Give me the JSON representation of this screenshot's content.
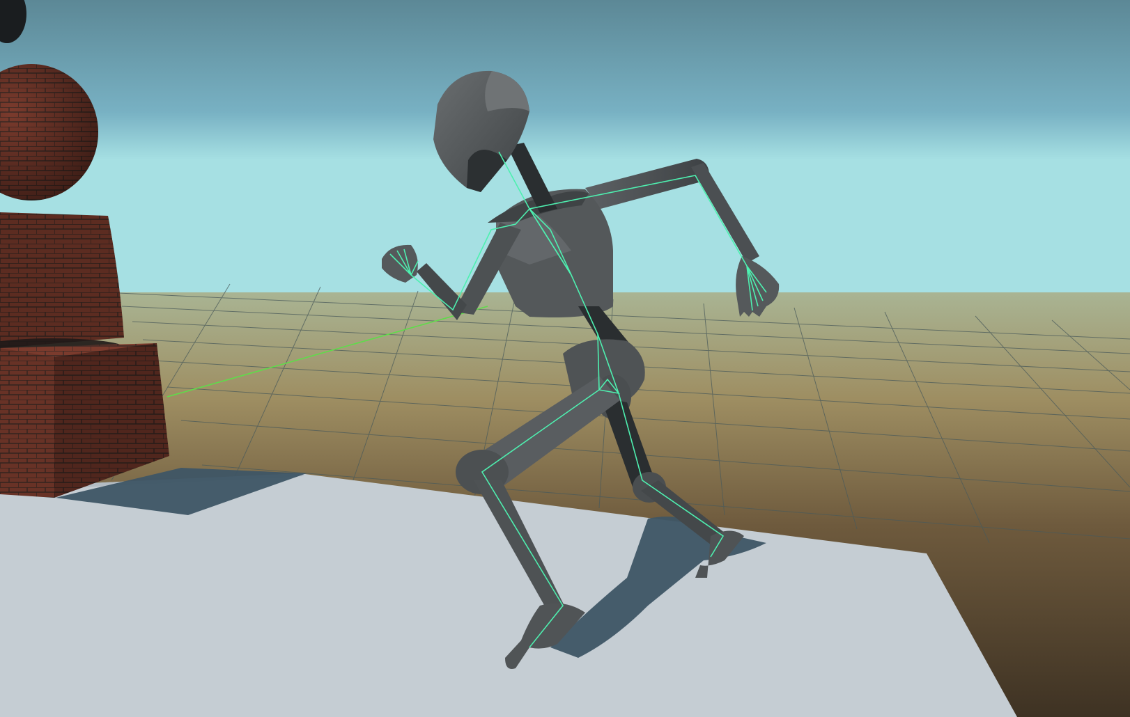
{
  "scene": {
    "view": "3d-viewport",
    "subject": "humanoid-mannequin",
    "pose": "running",
    "skeleton_overlay": true,
    "floor_grid": true,
    "props": [
      "brick-sphere",
      "brick-cylinder",
      "brick-cube",
      "dark-sphere"
    ]
  },
  "colors": {
    "sky_top": "#5c8896",
    "sky_horizon": "#a6e0e3",
    "ground_near": "#4a3d2c",
    "ground_far": "#a8a27c",
    "platform": "#c5cdd3",
    "mannequin": "#4f5355",
    "mannequin_joint": "#2a2e30",
    "skeleton": "#4ef0b0",
    "grid_line": "#4a5a5a",
    "x_axis": "#5fdc4a",
    "brick": "#7b3b2d",
    "shadow": "#3e5565"
  }
}
